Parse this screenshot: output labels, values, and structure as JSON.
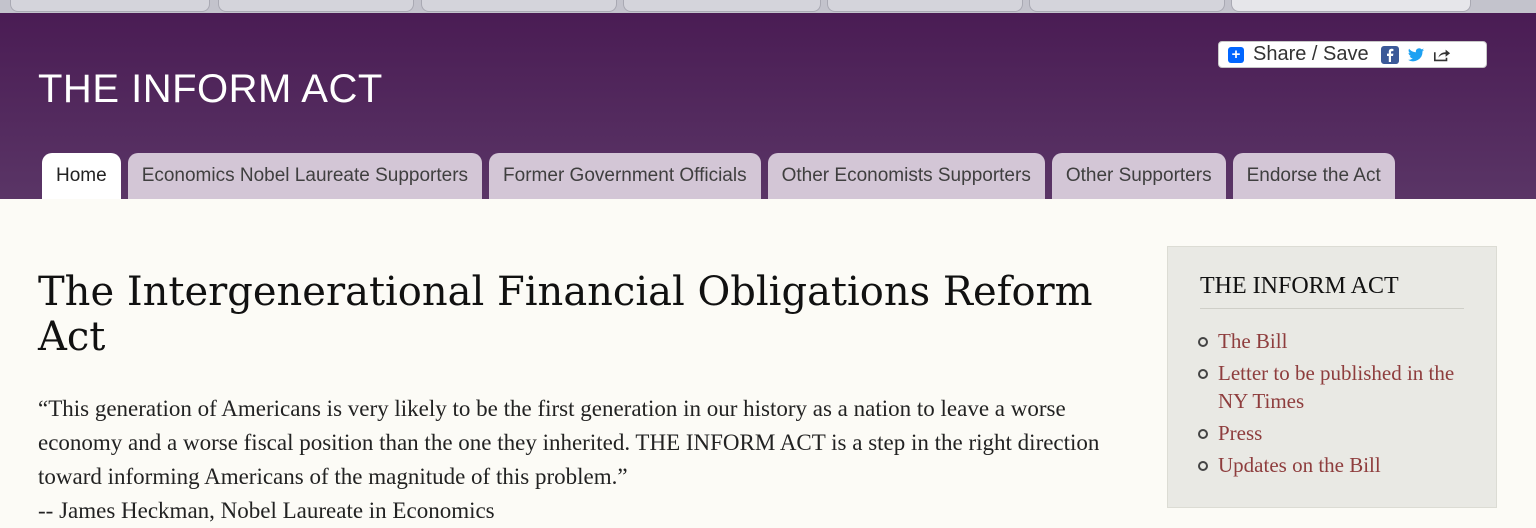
{
  "site": {
    "title": "THE INFORM ACT"
  },
  "share": {
    "label": "Share / Save"
  },
  "nav": {
    "tabs": [
      {
        "label": "Home",
        "active": true
      },
      {
        "label": "Economics Nobel Laureate Supporters",
        "active": false
      },
      {
        "label": "Former Government Officials",
        "active": false
      },
      {
        "label": "Other Economists Supporters",
        "active": false
      },
      {
        "label": "Other Supporters",
        "active": false
      },
      {
        "label": "Endorse the Act",
        "active": false
      }
    ]
  },
  "main": {
    "heading": "The Intergenerational Financial Obligations Reform Act",
    "quote": "“This generation of Americans is very likely to be the first generation in our history as a nation to leave a worse economy and a worse fiscal position than the one they inherited. THE INFORM ACT is a step in the right direction toward informing Americans of the magnitude of this problem.”",
    "attribution": "-- James Heckman, Nobel Laureate in Economics"
  },
  "sidebar": {
    "title": "THE INFORM ACT",
    "links": [
      {
        "label": "The Bill"
      },
      {
        "label": "Letter to be published in the NY Times"
      },
      {
        "label": "Press"
      },
      {
        "label": "Updates on the Bill"
      }
    ]
  },
  "colors": {
    "header": "#4a1c54",
    "tab": "#d3c6d6",
    "link": "#8e3d3d"
  }
}
